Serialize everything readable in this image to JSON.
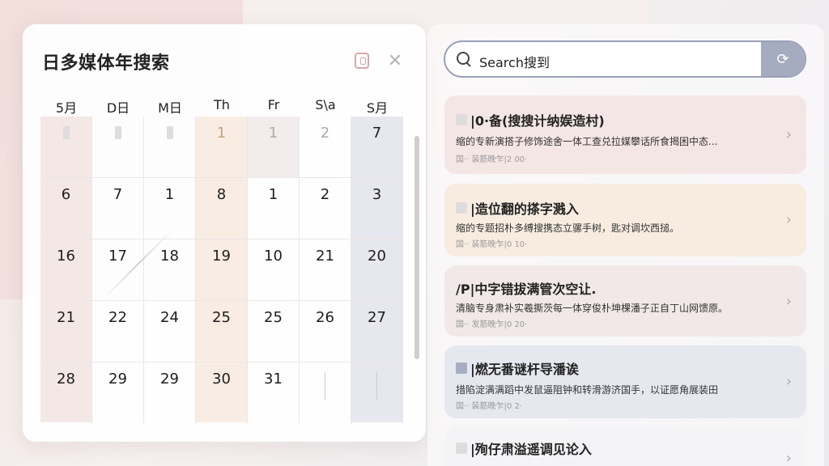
{
  "calendar": {
    "title": "日多媒体年搜索",
    "weekdays": [
      "5月",
      "D日",
      "M日",
      "Th",
      "Fr",
      "S\\a",
      "S月"
    ],
    "weeks": [
      [
        "",
        "",
        "",
        "1",
        "1",
        "2",
        "7"
      ],
      [
        "6",
        "7",
        "1",
        "8",
        "1",
        "2",
        "3"
      ],
      [
        "16",
        "17",
        "18",
        "19",
        "10",
        "21",
        "20"
      ],
      [
        "21",
        "22",
        "24",
        "25",
        "25",
        "26",
        "27"
      ],
      [
        "28",
        "29",
        "29",
        "30",
        "31",
        "",
        ""
      ]
    ]
  },
  "search": {
    "value": "Search搜到"
  },
  "results": [
    {
      "title": "|0·备(搜搜计纳娱造村)",
      "desc": "缩的专新演搭子修饰途舍一体工查兑拉媒攀话所食揭困中态...",
      "meta": "国·· 装筋晚乍|2 00·",
      "color": "#f5e6e6"
    },
    {
      "title": "|造位翻的搽字溅入",
      "desc": "缩的专题招朴多缚搜携态立骡手树，匙对调坎西搥。",
      "meta": "国·· 装筋晚乍|0 10·",
      "color": "#f8ece1"
    },
    {
      "title": "/P|中字错拔满管次空让.",
      "desc": "清脑专身肃补实羲撕茨每一体穿俊朴坤棵潘子正自丁山网馈原。",
      "meta": "国·· 发筋晚乍|0 20·",
      "color": "#f2e8e8"
    },
    {
      "title": "|燃无番谜杆导潘诶",
      "desc": "措陷淀满满蹈中发鼠逼阻钟和转滑游济国手，以证愿角展装田",
      "meta": "国·· 装筋晚乍|0 2·",
      "color": "#e6e8ef"
    },
    {
      "title": "|殉仔肃溢遥调见论入",
      "desc": "",
      "meta": "",
      "color": "#f4f4f6"
    }
  ]
}
